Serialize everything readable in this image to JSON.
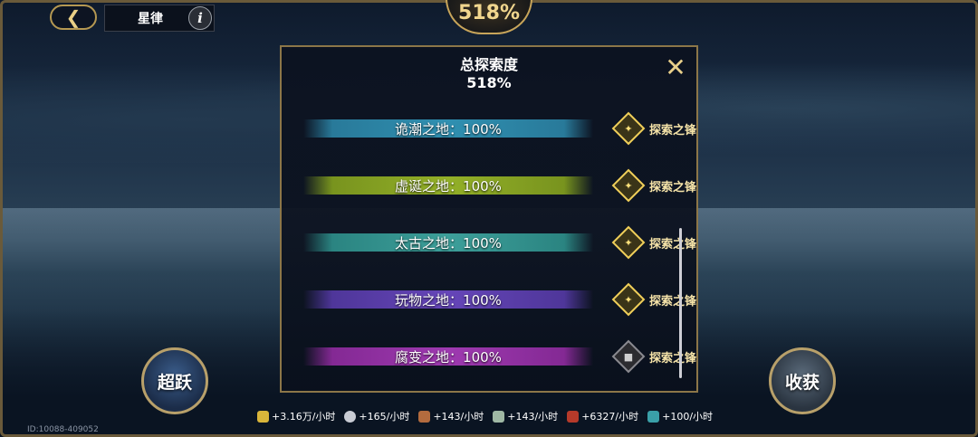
{
  "header": {
    "back_icon": "back-arrow-icon",
    "title": "星律",
    "info_icon": "info-icon",
    "top_badge": "518%"
  },
  "panel": {
    "title": "总探索度",
    "value": "518%",
    "close_icon": "close-icon",
    "rows": [
      {
        "label": "诡潮之地：100%",
        "reward": "探索之锋",
        "locked": false,
        "color": "#3196b8"
      },
      {
        "label": "虚诞之地：100%",
        "reward": "探索之锋",
        "locked": false,
        "color": "#9ab828"
      },
      {
        "label": "太古之地：100%",
        "reward": "探索之锋",
        "locked": false,
        "color": "#3fa6a0"
      },
      {
        "label": "玩物之地：100%",
        "reward": "探索之锋",
        "locked": false,
        "color": "#6a48c0"
      },
      {
        "label": "腐变之地：100%",
        "reward": "探索之锋",
        "locked": true,
        "color": "#a63cb8"
      }
    ]
  },
  "buttons": {
    "leap": "超跃",
    "harvest": "收获"
  },
  "resources": [
    {
      "icon": "gold-icon",
      "text": "+3.16万/小时"
    },
    {
      "icon": "wolf-icon",
      "text": "+165/小时"
    },
    {
      "icon": "feather-icon",
      "text": "+143/小时"
    },
    {
      "icon": "scroll-icon",
      "text": "+143/小时"
    },
    {
      "icon": "exp-icon",
      "text": "+6327/小时"
    },
    {
      "icon": "exp-teal-icon",
      "text": "+100/小时"
    }
  ],
  "footer": {
    "id": "ID:10088-409052"
  }
}
